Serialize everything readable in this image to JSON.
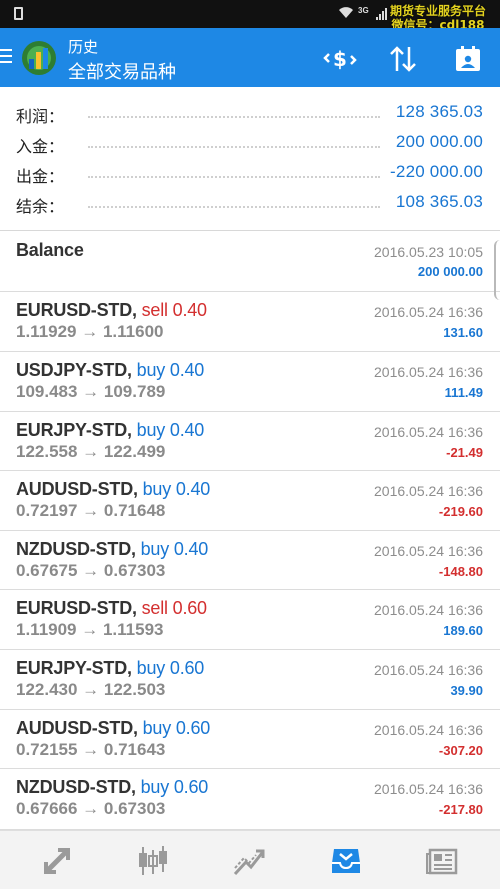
{
  "status_bar": {
    "net": "3G",
    "watermark_line1": "期货专业服务平台",
    "watermark_line2": "微信号：cdl188"
  },
  "app_bar": {
    "title": "历史",
    "subtitle": "全部交易品种"
  },
  "summary": [
    {
      "label": "利润：",
      "value": "128 365.03"
    },
    {
      "label": "入金：",
      "value": "200 000.00"
    },
    {
      "label": "出金：",
      "value": "-220 000.00"
    },
    {
      "label": "结余：",
      "value": "108 365.03"
    }
  ],
  "balance": {
    "label": "Balance",
    "time": "2016.05.23 10:05",
    "amount": "200 000.00"
  },
  "trades": [
    {
      "symbol": "EURUSD-STD,",
      "side": "sell 0.40",
      "type": "sell",
      "prices": "1.11929 → 1.11600",
      "time": "2016.05.24 16:36",
      "profit": "131.60",
      "profit_sign": "pos"
    },
    {
      "symbol": "USDJPY-STD,",
      "side": "buy 0.40",
      "type": "buy",
      "prices": "109.483 → 109.789",
      "time": "2016.05.24 16:36",
      "profit": "111.49",
      "profit_sign": "pos"
    },
    {
      "symbol": "EURJPY-STD,",
      "side": "buy 0.40",
      "type": "buy",
      "prices": "122.558 → 122.499",
      "time": "2016.05.24 16:36",
      "profit": "-21.49",
      "profit_sign": "neg"
    },
    {
      "symbol": "AUDUSD-STD,",
      "side": "buy 0.40",
      "type": "buy",
      "prices": "0.72197 → 0.71648",
      "time": "2016.05.24 16:36",
      "profit": "-219.60",
      "profit_sign": "neg"
    },
    {
      "symbol": "NZDUSD-STD,",
      "side": "buy 0.40",
      "type": "buy",
      "prices": "0.67675 → 0.67303",
      "time": "2016.05.24 16:36",
      "profit": "-148.80",
      "profit_sign": "neg"
    },
    {
      "symbol": "EURUSD-STD,",
      "side": "sell 0.60",
      "type": "sell",
      "prices": "1.11909 → 1.11593",
      "time": "2016.05.24 16:36",
      "profit": "189.60",
      "profit_sign": "pos"
    },
    {
      "symbol": "EURJPY-STD,",
      "side": "buy 0.60",
      "type": "buy",
      "prices": "122.430 → 122.503",
      "time": "2016.05.24 16:36",
      "profit": "39.90",
      "profit_sign": "pos"
    },
    {
      "symbol": "AUDUSD-STD,",
      "side": "buy 0.60",
      "type": "buy",
      "prices": "0.72155 → 0.71643",
      "time": "2016.05.24 16:36",
      "profit": "-307.20",
      "profit_sign": "neg"
    },
    {
      "symbol": "NZDUSD-STD,",
      "side": "buy 0.60",
      "type": "buy",
      "prices": "0.67666 → 0.67303",
      "time": "2016.05.24 16:36",
      "profit": "-217.80",
      "profit_sign": "neg"
    }
  ],
  "icons": {
    "toolbar": [
      "currency-exchange-icon",
      "sort-icon",
      "calendar-icon"
    ],
    "bottom_nav": [
      "quotes-icon",
      "chart-icon",
      "trade-icon",
      "history-icon",
      "news-icon"
    ]
  },
  "colors": {
    "accent": "#1e88e5",
    "positive": "#1976d2",
    "negative": "#d32f2f",
    "bottom_nav_active": "#1e88e5",
    "bottom_nav_inactive": "#9a9a9a"
  }
}
